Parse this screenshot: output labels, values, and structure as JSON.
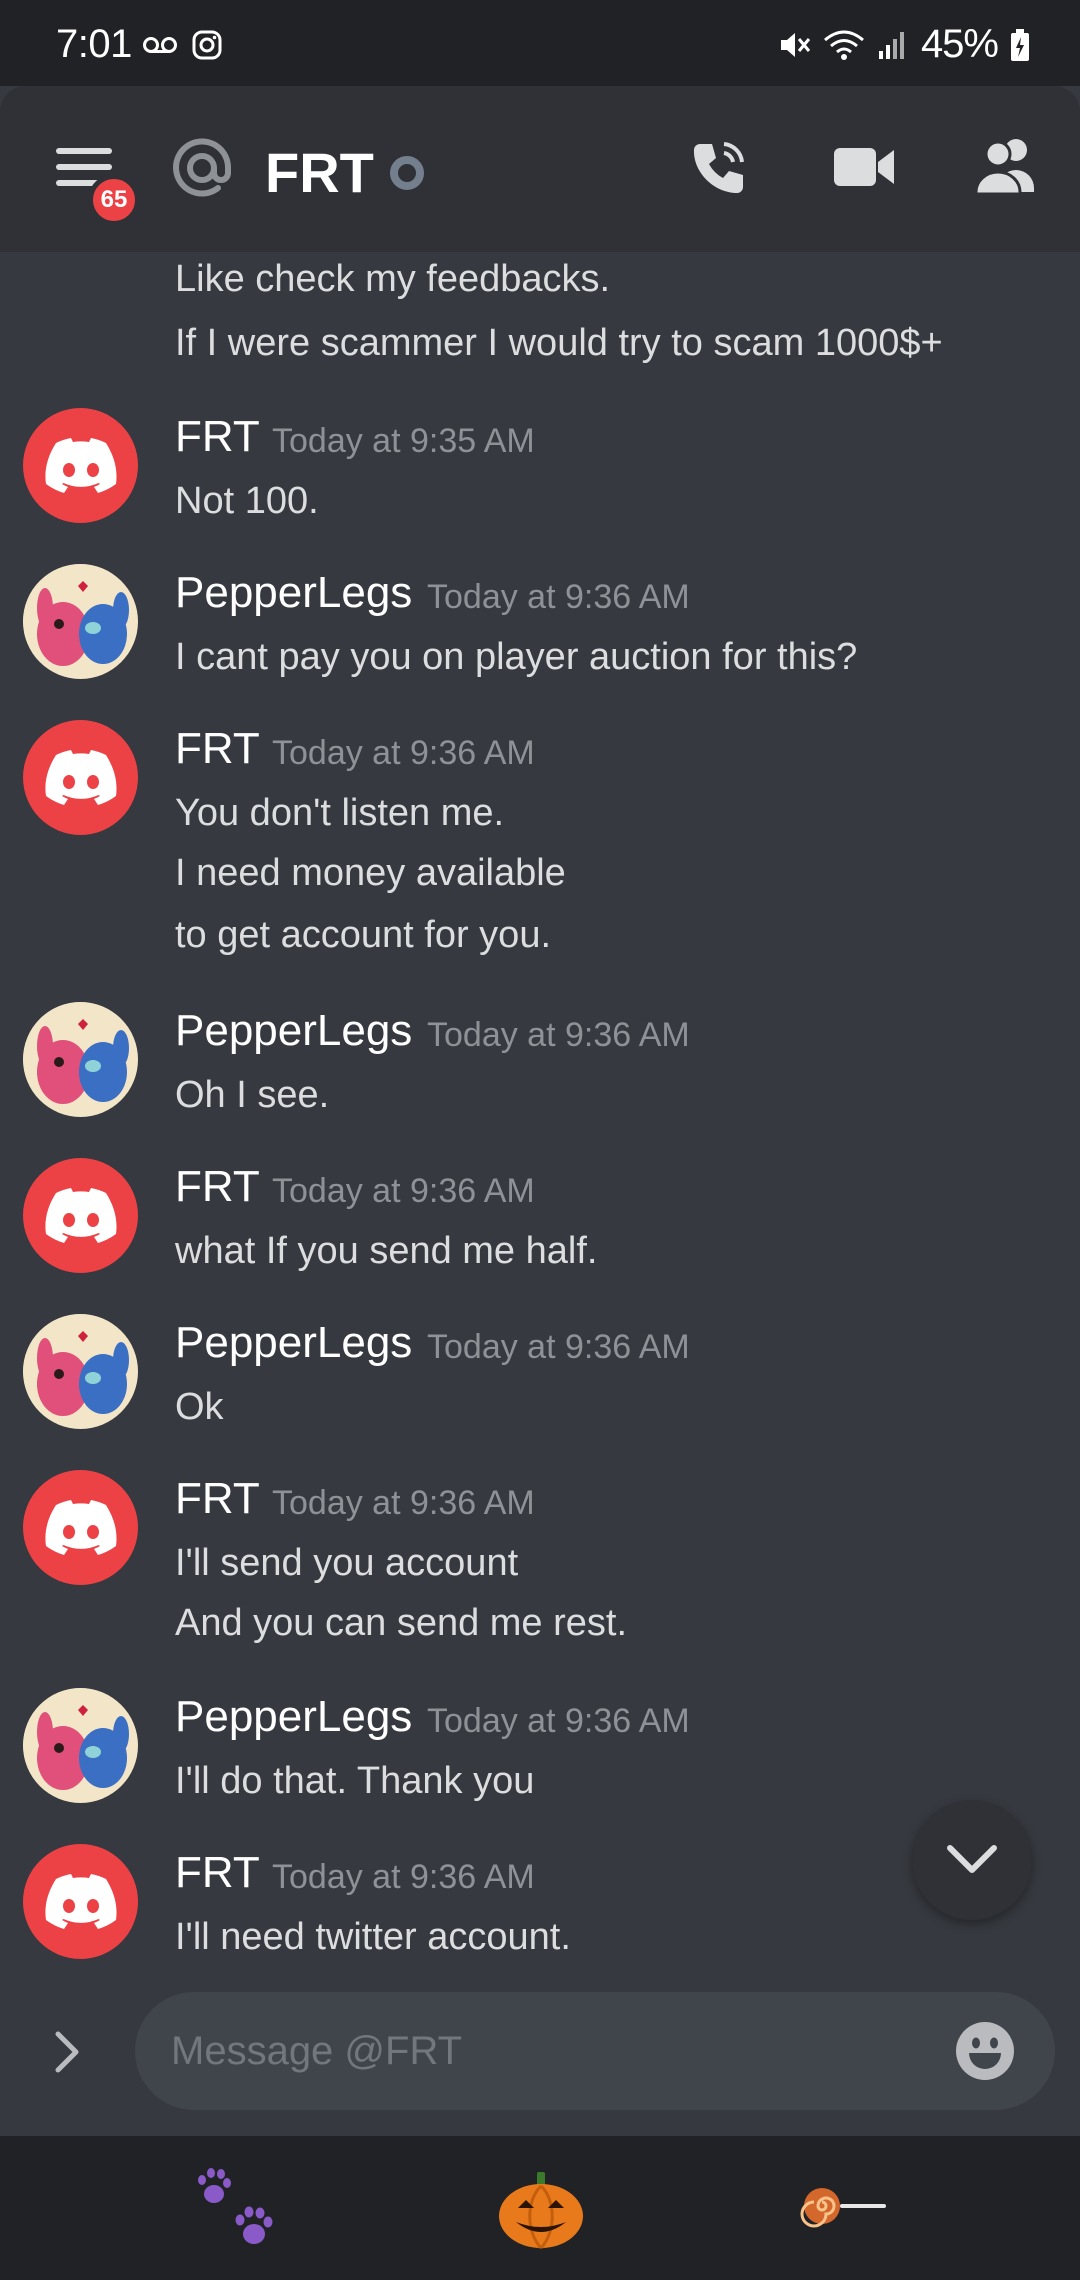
{
  "status_bar": {
    "time": "7:01",
    "battery": "45%"
  },
  "header": {
    "unread_count": "65",
    "channel_name": "FRT"
  },
  "messages": [
    {
      "type": "continuation",
      "lines": [
        "Like check my feedbacks.",
        "If I were scammer I would try to scam 1000$+"
      ]
    },
    {
      "type": "group",
      "author": "FRT",
      "avatar": "discord-logo",
      "time": "Today at 9:35 AM",
      "lines": [
        "Not 100."
      ]
    },
    {
      "type": "group",
      "author": "PepperLegs",
      "avatar": "pepper-avatar",
      "time": "Today at 9:36 AM",
      "lines": [
        "I cant pay you on player auction for this?"
      ]
    },
    {
      "type": "group",
      "author": "FRT",
      "avatar": "discord-logo",
      "time": "Today at 9:36 AM",
      "lines": [
        "You don't listen me.",
        "I need money available",
        "to get account for you."
      ]
    },
    {
      "type": "group",
      "author": "PepperLegs",
      "avatar": "pepper-avatar",
      "time": "Today at 9:36 AM",
      "lines": [
        "Oh I see."
      ]
    },
    {
      "type": "group",
      "author": "FRT",
      "avatar": "discord-logo",
      "time": "Today at 9:36 AM",
      "lines": [
        "what If you send me half."
      ]
    },
    {
      "type": "group",
      "author": "PepperLegs",
      "avatar": "pepper-avatar",
      "time": "Today at 9:36 AM",
      "lines": [
        "Ok"
      ]
    },
    {
      "type": "group",
      "author": "FRT",
      "avatar": "discord-logo",
      "time": "Today at 9:36 AM",
      "lines": [
        "I'll send you account",
        "And you can send me rest."
      ]
    },
    {
      "type": "group",
      "author": "PepperLegs",
      "avatar": "pepper-avatar",
      "time": "Today at 9:36 AM",
      "lines": [
        "I'll do that. Thank you"
      ]
    },
    {
      "type": "group",
      "author": "FRT",
      "avatar": "discord-logo",
      "time": "Today at 9:36 AM",
      "lines": [
        "I'll need twitter account."
      ]
    }
  ],
  "composer": {
    "placeholder": "Message @FRT"
  },
  "nav_bar": {
    "items": [
      "paw-prints-icon",
      "pumpkin-icon",
      "lollipop-icon"
    ]
  },
  "colors": {
    "background": "#36393f",
    "header": "#2f3136",
    "status_bar": "#202225",
    "discord_red": "#ed4245",
    "timestamp": "#8e9297"
  }
}
